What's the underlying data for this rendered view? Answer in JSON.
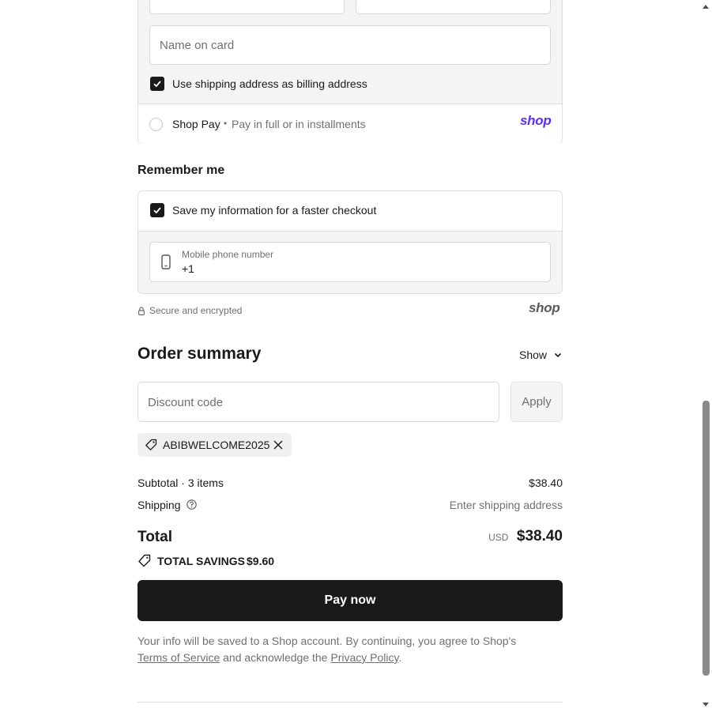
{
  "payment": {
    "name_on_card_placeholder": "Name on card",
    "use_shipping_label": "Use shipping address as billing address",
    "use_shipping_checked": true,
    "shop_pay_label": "Shop Pay",
    "shop_pay_separator": "•",
    "shop_pay_sub": "Pay in full or in installments",
    "shop_logo": "shop"
  },
  "remember": {
    "heading": "Remember me",
    "save_info_label": "Save my information for a faster checkout",
    "save_info_checked": true,
    "phone_label": "Mobile phone number",
    "phone_value": "+1",
    "phone_icon": "mobile-phone-icon"
  },
  "secure": {
    "text": "Secure and encrypted",
    "icon": "lock-icon",
    "shop_logo": "shop"
  },
  "summary": {
    "heading": "Order summary",
    "show_label": "Show",
    "discount_placeholder": "Discount code",
    "apply_label": "Apply",
    "applied_code": "ABIBWELCOME2025",
    "subtotal_label": "Subtotal · 3 items",
    "subtotal_value": "$38.40",
    "shipping_label": "Shipping",
    "shipping_value": "Enter shipping address",
    "total_label": "Total",
    "currency": "USD",
    "total_value": "$38.40",
    "savings_label": "TOTAL SAVINGS",
    "savings_value": "$9.60"
  },
  "pay_button": "Pay now",
  "footer": {
    "text_1": "Your info will be saved to a Shop account. By continuing, you agree to Shop's",
    "terms_link": "Terms of Service",
    "text_2": " and acknowledge the ",
    "privacy_link": "Privacy Policy",
    "text_3": "."
  },
  "colors": {
    "accent_shop": "#5a31f4",
    "button_bg": "#1a1a1a",
    "panel_bg": "#f5f5f5"
  }
}
